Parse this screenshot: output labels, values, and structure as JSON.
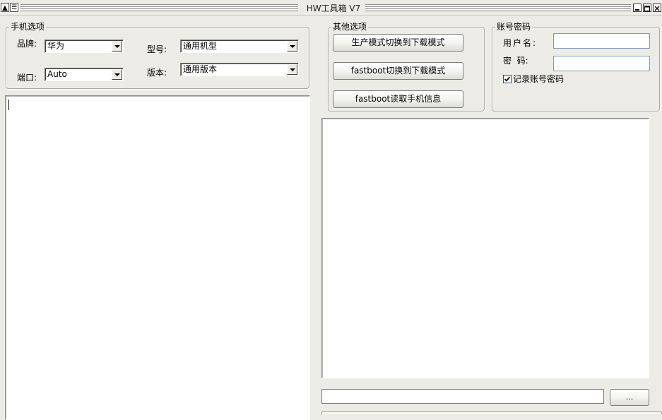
{
  "window": {
    "title": "HW工具箱 V7"
  },
  "phone_options": {
    "legend": "手机选项",
    "brand_label": "品牌:",
    "brand_value": "华为",
    "model_label": "型号:",
    "model_value": "通用机型",
    "port_label": "端口:",
    "port_value": "Auto",
    "version_label": "版本:",
    "version_value": "通用版本"
  },
  "other_options": {
    "legend": "其他选项",
    "btn_production_to_download": "生产模式切换到下载模式",
    "btn_fastboot_to_download": "fastboot切换到下载模式",
    "btn_fastboot_read_info": "fastboot读取手机信息"
  },
  "account": {
    "legend": "账号密码",
    "username_label": "用户名:",
    "username_value": "",
    "password_label": "密  码:",
    "password_value": "",
    "remember_label": "记录账号密码",
    "remember_checked": true
  },
  "file": {
    "path_value": "",
    "browse_label": "..."
  }
}
